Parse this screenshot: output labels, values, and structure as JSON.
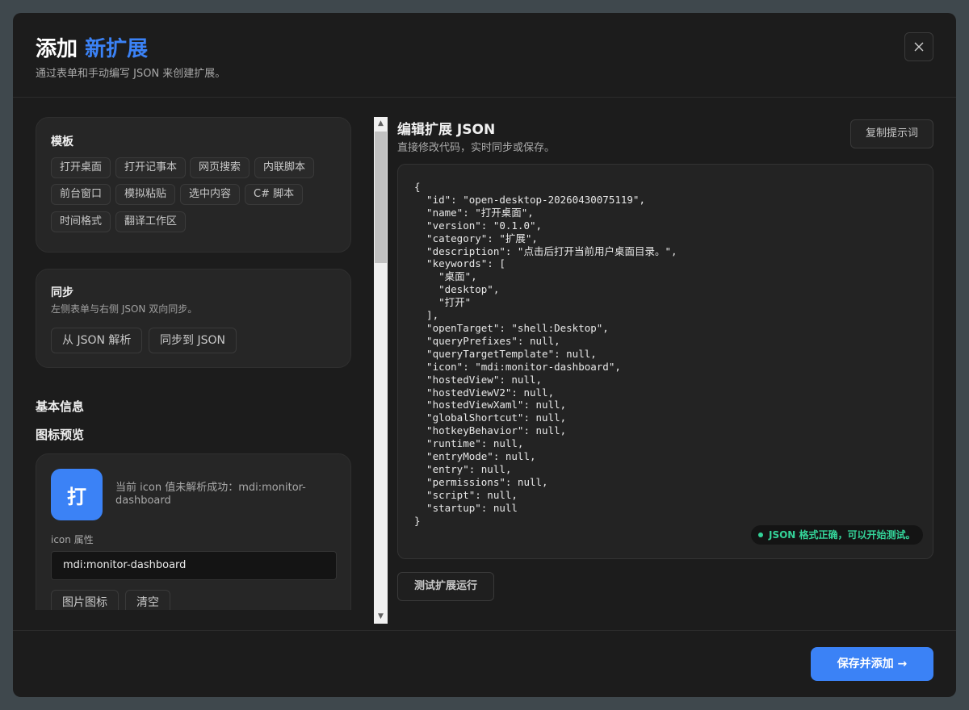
{
  "header": {
    "title_prefix": "添加",
    "title_accent": "新扩展",
    "subtitle": "通过表单和手动编写 JSON 来创建扩展。",
    "close_icon": "close-icon"
  },
  "templates": {
    "title": "模板",
    "items": [
      "打开桌面",
      "打开记事本",
      "网页搜索",
      "内联脚本",
      "前台窗口",
      "模拟粘贴",
      "选中内容",
      "C# 脚本",
      "时间格式",
      "翻译工作区"
    ]
  },
  "sync": {
    "title": "同步",
    "description": "左侧表单与右侧 JSON 双向同步。",
    "parse_button": "从 JSON 解析",
    "sync_button": "同步到 JSON"
  },
  "basic_info": {
    "title": "基本信息"
  },
  "icon_preview": {
    "title": "图标预览",
    "glyph": "打",
    "status": "当前 icon 值未解析成功：mdi:monitor-dashboard",
    "field_label": "icon 属性",
    "field_value": "mdi:monitor-dashboard",
    "image_icon_button": "图片图标",
    "clear_button": "清空"
  },
  "editor": {
    "title": "编辑扩展 JSON",
    "subtitle": "直接修改代码，实时同步或保存。",
    "copy_button": "复制提示词",
    "code": "{\n  \"id\": \"open-desktop-20260430075119\",\n  \"name\": \"打开桌面\",\n  \"version\": \"0.1.0\",\n  \"category\": \"扩展\",\n  \"description\": \"点击后打开当前用户桌面目录。\",\n  \"keywords\": [\n    \"桌面\",\n    \"desktop\",\n    \"打开\"\n  ],\n  \"openTarget\": \"shell:Desktop\",\n  \"queryPrefixes\": null,\n  \"queryTargetTemplate\": null,\n  \"icon\": \"mdi:monitor-dashboard\",\n  \"hostedView\": null,\n  \"hostedViewV2\": null,\n  \"hostedViewXaml\": null,\n  \"globalShortcut\": null,\n  \"hotkeyBehavior\": null,\n  \"runtime\": null,\n  \"entryMode\": null,\n  \"entry\": null,\n  \"permissions\": null,\n  \"script\": null,\n  \"startup\": null\n}",
    "status": "JSON 格式正确，可以开始测试。",
    "test_button": "测试扩展运行"
  },
  "footer": {
    "save_button": "保存并添加 →"
  },
  "colors": {
    "accent": "#3b82f6",
    "success": "#34d399",
    "background": "#1c1c1c"
  }
}
